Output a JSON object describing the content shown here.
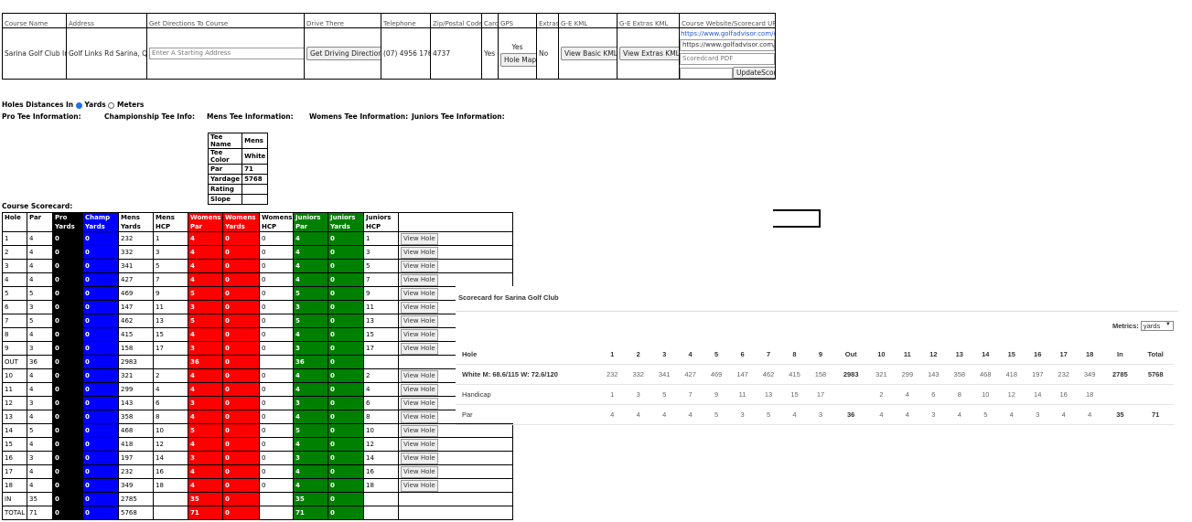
{
  "course_info": {
    "headers": [
      "Course Name",
      "Address",
      "Get Directions To Course",
      "Drive There",
      "Telephone",
      "Zip/Postal Code",
      "Card",
      "GPS",
      "Extras",
      "G-E KML",
      "G-E Extras KML",
      "Course Website/Scorecard UF"
    ],
    "course_name": "Sarina Golf Club Inc",
    "address": "Golf Links Rd Sarina, QD",
    "directions_placeholder": "Enter A Starting Address",
    "drive_button": "Get Driving Directions",
    "telephone": "(07) 4956 1761",
    "zip": "4737",
    "card": "Yes",
    "gps": "Yes",
    "hole_map_button": "Hole Map",
    "extras": "No",
    "basic_kml_button": "View Basic KML",
    "extras_kml_button": "View Extras KML",
    "website_link": "https://www.golfadvisor.com/co",
    "scorecard_url_input": "https://www.golfadvisor.com/c",
    "scorecard_pdf_placeholder": "Scoredcard PDF",
    "update_button": "UpdateScor"
  },
  "distances": {
    "label": "Holes Distances In",
    "opt_yards": "Yards",
    "opt_meters": "Meters",
    "selected": "yards"
  },
  "tee_headings": {
    "pro": "Pro Tee Information:",
    "champ": "Championship Tee Info:",
    "mens": "Mens Tee Information:",
    "womens": "Womens Tee Information:",
    "juniors": "Juniors Tee Information:"
  },
  "mens_tee": {
    "rows": [
      [
        "Tee Name",
        "Mens"
      ],
      [
        "Tee Color",
        "White"
      ],
      [
        "Par",
        "71"
      ],
      [
        "Yardage",
        "5768"
      ],
      [
        "Rating",
        ""
      ],
      [
        "Slope",
        ""
      ]
    ]
  },
  "scorecard": {
    "title": "Course Scorecard:",
    "headers": [
      "Hole",
      "Par",
      "Pro Yards",
      "Champ Yards",
      "Mens Yards",
      "Mens HCP",
      "Womens Par",
      "Womens Yards",
      "Womens HCP",
      "Juniors Par",
      "Juniors Yards",
      "Juniors HCP"
    ],
    "view_label": "View Hole",
    "rows": [
      [
        "1",
        "4",
        "0",
        "0",
        "232",
        "1",
        "4",
        "0",
        "0",
        "4",
        "0",
        "1"
      ],
      [
        "2",
        "4",
        "0",
        "0",
        "332",
        "3",
        "4",
        "0",
        "0",
        "4",
        "0",
        "3"
      ],
      [
        "3",
        "4",
        "0",
        "0",
        "341",
        "5",
        "4",
        "0",
        "0",
        "4",
        "0",
        "5"
      ],
      [
        "4",
        "4",
        "0",
        "0",
        "427",
        "7",
        "4",
        "0",
        "0",
        "4",
        "0",
        "7"
      ],
      [
        "5",
        "5",
        "0",
        "0",
        "469",
        "9",
        "5",
        "0",
        "0",
        "5",
        "0",
        "9"
      ],
      [
        "6",
        "3",
        "0",
        "0",
        "147",
        "11",
        "3",
        "0",
        "0",
        "3",
        "0",
        "11"
      ],
      [
        "7",
        "5",
        "0",
        "0",
        "462",
        "13",
        "5",
        "0",
        "0",
        "5",
        "0",
        "13"
      ],
      [
        "8",
        "4",
        "0",
        "0",
        "415",
        "15",
        "4",
        "0",
        "0",
        "4",
        "0",
        "15"
      ],
      [
        "9",
        "3",
        "0",
        "0",
        "158",
        "17",
        "3",
        "0",
        "0",
        "3",
        "0",
        "17"
      ],
      [
        "OUT",
        "36",
        "0",
        "0",
        "2983",
        "",
        "36",
        "0",
        "",
        "36",
        "0",
        ""
      ],
      [
        "10",
        "4",
        "0",
        "0",
        "321",
        "2",
        "4",
        "0",
        "0",
        "4",
        "0",
        "2"
      ],
      [
        "11",
        "4",
        "0",
        "0",
        "299",
        "4",
        "4",
        "0",
        "0",
        "4",
        "0",
        "4"
      ],
      [
        "12",
        "3",
        "0",
        "0",
        "143",
        "6",
        "3",
        "0",
        "0",
        "3",
        "0",
        "6"
      ],
      [
        "13",
        "4",
        "0",
        "0",
        "358",
        "8",
        "4",
        "0",
        "0",
        "4",
        "0",
        "8"
      ],
      [
        "14",
        "5",
        "0",
        "0",
        "468",
        "10",
        "5",
        "0",
        "0",
        "5",
        "0",
        "10"
      ],
      [
        "15",
        "4",
        "0",
        "0",
        "418",
        "12",
        "4",
        "0",
        "0",
        "4",
        "0",
        "12"
      ],
      [
        "16",
        "3",
        "0",
        "0",
        "197",
        "14",
        "3",
        "0",
        "0",
        "3",
        "0",
        "14"
      ],
      [
        "17",
        "4",
        "0",
        "0",
        "232",
        "16",
        "4",
        "0",
        "0",
        "4",
        "0",
        "16"
      ],
      [
        "18",
        "4",
        "0",
        "0",
        "349",
        "18",
        "4",
        "0",
        "0",
        "4",
        "0",
        "18"
      ],
      [
        "IN",
        "35",
        "0",
        "0",
        "2785",
        "",
        "35",
        "0",
        "",
        "35",
        "0",
        ""
      ],
      [
        "TOTAL",
        "71",
        "0",
        "0",
        "5768",
        "",
        "71",
        "0",
        "",
        "71",
        "0",
        ""
      ]
    ]
  },
  "overlay": {
    "title": "Scorecard for Sarina Golf Club",
    "metrics_label": "Metrics:",
    "metrics_value": "yards",
    "rows": [
      [
        "Hole",
        "1",
        "2",
        "3",
        "4",
        "5",
        "6",
        "7",
        "8",
        "9",
        "Out",
        "10",
        "11",
        "12",
        "13",
        "14",
        "15",
        "16",
        "17",
        "18",
        "In",
        "Total"
      ],
      [
        "White M: 68.6/115 W: 72.6/120",
        "232",
        "332",
        "341",
        "427",
        "469",
        "147",
        "462",
        "415",
        "158",
        "2983",
        "321",
        "299",
        "143",
        "358",
        "468",
        "418",
        "197",
        "232",
        "349",
        "2785",
        "5768"
      ],
      [
        "Handicap",
        "1",
        "3",
        "5",
        "7",
        "9",
        "11",
        "13",
        "15",
        "17",
        "",
        "2",
        "4",
        "6",
        "8",
        "10",
        "12",
        "14",
        "16",
        "18",
        "",
        ""
      ],
      [
        "Par",
        "4",
        "4",
        "4",
        "4",
        "5",
        "3",
        "5",
        "4",
        "3",
        "36",
        "4",
        "4",
        "3",
        "4",
        "5",
        "4",
        "3",
        "4",
        "4",
        "35",
        "71"
      ]
    ]
  },
  "colors": {
    "pro": "#000000",
    "champ": "#0000ff",
    "womens": "#ff0000",
    "juniors": "#008000"
  }
}
